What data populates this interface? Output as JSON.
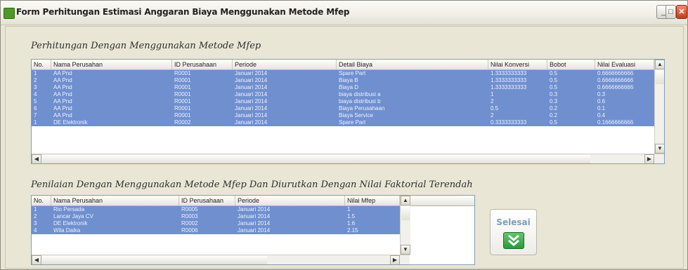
{
  "window": {
    "title": "Form Perhitungan Estimasi Anggaran Biaya Menggunakan Metode Mfep",
    "min_glyph": "_",
    "max_glyph": "□",
    "close_glyph": "✕"
  },
  "section1": {
    "title": "Perhitungan Dengan Menggunakan Metode Mfep",
    "columns": [
      "No.",
      "Nama Perusahan",
      "ID Perusahaan",
      "Periode",
      "Detail Biaya",
      "Nilai Konversi",
      "Bobot",
      "Nilai Evaluasi"
    ],
    "rows": [
      [
        "1",
        "AA Pnd",
        "R0001",
        "Januari  2014",
        "Spare Part",
        "1.3333333333",
        "0.5",
        "0.6666666666"
      ],
      [
        "2",
        "AA Pnd",
        "R0001",
        "Januari  2014",
        "Biaya B",
        "1.3333333333",
        "0.5",
        "0.6666666666"
      ],
      [
        "3",
        "AA Pnd",
        "R0001",
        "Januari  2014",
        "Biaya D",
        "1.3333333333",
        "0.5",
        "0.6666666666"
      ],
      [
        "4",
        "AA Pnd",
        "R0001",
        "Januari  2014",
        "biaya distribusi a",
        "1",
        "0.3",
        "0.3"
      ],
      [
        "5",
        "AA Pnd",
        "R0001",
        "Januari  2014",
        "biaya distribusi b",
        "2",
        "0.3",
        "0.6"
      ],
      [
        "6",
        "AA Pnd",
        "R0001",
        "Januari  2014",
        "Biaya Perusahaan",
        "0.5",
        "0.2",
        "0.1"
      ],
      [
        "7",
        "AA Pnd",
        "R0001",
        "Januari  2014",
        "Biaya Service",
        "2",
        "0.2",
        "0.4"
      ],
      [
        "1",
        "DE Elektronik",
        "R0002",
        "Januari  2014",
        "Spare Part",
        "0.3333333333",
        "0.5",
        "0.1666666666"
      ]
    ]
  },
  "section2": {
    "title": "Penilaian Dengan Menggunakan Metode Mfep Dan Diurutkan Dengan Nilai Faktorial Terendah",
    "columns": [
      "No.",
      "Nama Perusahan",
      "ID Perusahaan",
      "Periode",
      "Nilai Mfep"
    ],
    "rows": [
      [
        "1",
        "Rio Persada",
        "R0005",
        "Januari  2014",
        "1"
      ],
      [
        "2",
        "Lancar Jaya CV",
        "R0003",
        "Januari  2014",
        "1.5"
      ],
      [
        "3",
        "DE Elektronik",
        "R0002",
        "Januari  2014",
        "1.6"
      ],
      [
        "4",
        "Wila Daika",
        "R0006",
        "Januari  2014",
        "2.15"
      ]
    ]
  },
  "selesai_button": {
    "label": "Selesai",
    "icon": "double-chevron-down-icon"
  },
  "colors": {
    "selection": "#6f8fcf",
    "button_green": "#2a9a3b"
  }
}
